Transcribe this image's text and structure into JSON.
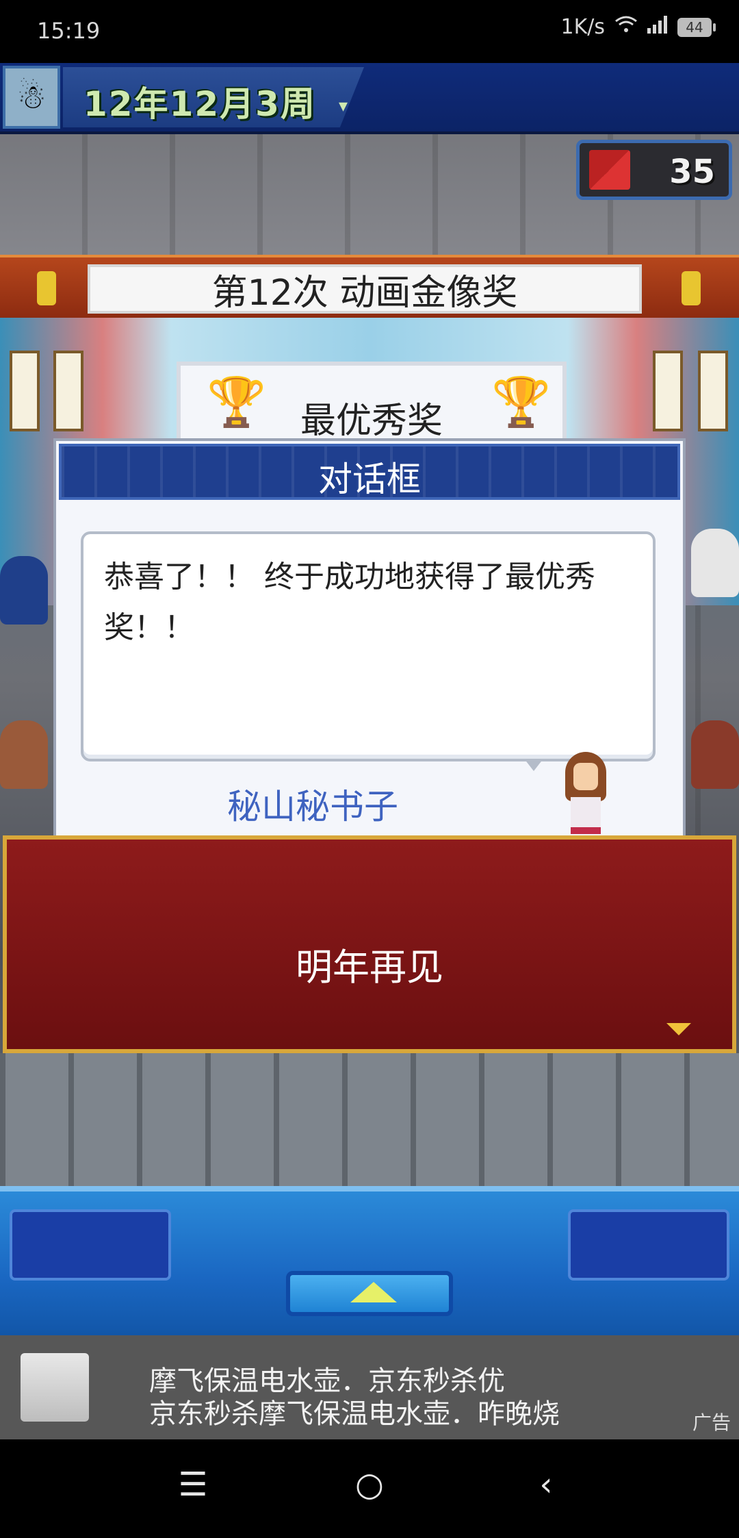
{
  "status_bar": {
    "time": "15:19",
    "network_speed": "1K/s",
    "battery": "44"
  },
  "game": {
    "date": "12年12月3周",
    "counter_value": "35",
    "award_banner_title": "第12次 动画金像奖",
    "award_category": "最优秀奖"
  },
  "dialog": {
    "title": "对话框",
    "message": "恭喜了！！ 终于成功地获得了最优秀奖！！",
    "speaker": "秘山秘书子"
  },
  "red_panel": {
    "text": "明年再见"
  },
  "ad": {
    "line1": "摩飞保温电水壶．京东秒杀优",
    "line2": "京东秒杀摩飞保温电水壶．昨晚烧",
    "tag": "广告"
  },
  "nav": {
    "menu": "☰",
    "home": "○",
    "back": "‹"
  }
}
